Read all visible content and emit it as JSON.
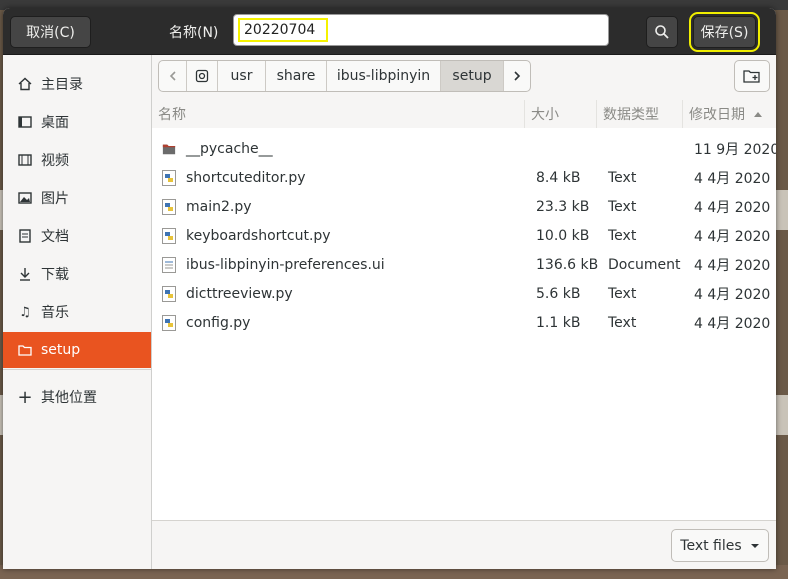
{
  "header": {
    "cancel_label": "取消(C)",
    "name_label": "名称(N)",
    "filename_value": "20220704",
    "save_label": "保存(S)"
  },
  "sidebar": {
    "items": [
      {
        "label": "主目录",
        "icon": "home-icon"
      },
      {
        "label": "桌面",
        "icon": "desktop-icon"
      },
      {
        "label": "视频",
        "icon": "video-icon"
      },
      {
        "label": "图片",
        "icon": "picture-icon"
      },
      {
        "label": "文档",
        "icon": "document-icon"
      },
      {
        "label": "下载",
        "icon": "download-icon"
      },
      {
        "label": "音乐",
        "icon": "music-icon"
      },
      {
        "label": "setup",
        "icon": "folder-icon"
      }
    ],
    "other_locations": "其他位置"
  },
  "pathbar": {
    "crumbs": [
      "usr",
      "share",
      "ibus-libpinyin",
      "setup"
    ]
  },
  "columns": {
    "name": "名称",
    "size": "大小",
    "type": "数据类型",
    "modified": "修改日期"
  },
  "files": [
    {
      "name": "__pycache__",
      "size": "",
      "type": "",
      "modified": "11 9月 2020",
      "icon": "folder-icon"
    },
    {
      "name": "shortcuteditor.py",
      "size": "8.4 kB",
      "type": "Text",
      "modified": "4 4月 2020",
      "icon": "python-file-icon"
    },
    {
      "name": "main2.py",
      "size": "23.3 kB",
      "type": "Text",
      "modified": "4 4月 2020",
      "icon": "python-file-icon"
    },
    {
      "name": "keyboardshortcut.py",
      "size": "10.0 kB",
      "type": "Text",
      "modified": "4 4月 2020",
      "icon": "python-file-icon"
    },
    {
      "name": "ibus-libpinyin-preferences.ui",
      "size": "136.6 kB",
      "type": "Document",
      "modified": "4 4月 2020",
      "icon": "ui-file-icon"
    },
    {
      "name": "dicttreeview.py",
      "size": "5.6 kB",
      "type": "Text",
      "modified": "4 4月 2020",
      "icon": "python-file-icon"
    },
    {
      "name": "config.py",
      "size": "1.1 kB",
      "type": "Text",
      "modified": "4 4月 2020",
      "icon": "python-file-icon"
    }
  ],
  "filter": {
    "label": "Text files"
  },
  "colors": {
    "accent": "#e95420",
    "highlight": "#f5f200",
    "header_bg": "#2c2c2c"
  }
}
